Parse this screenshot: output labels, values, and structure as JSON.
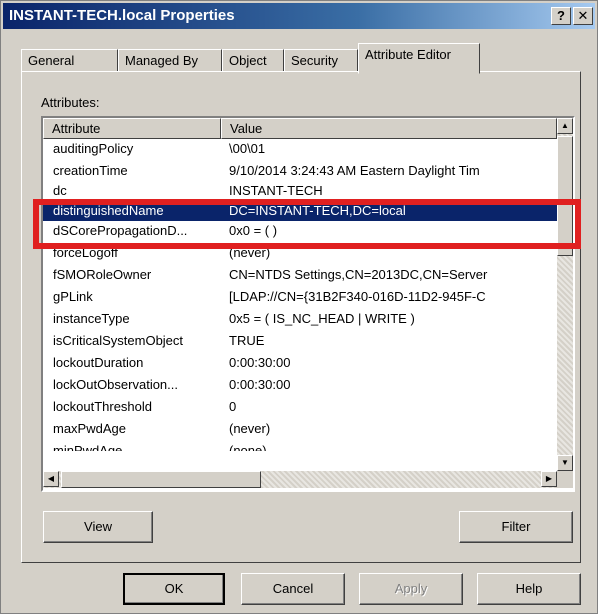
{
  "window": {
    "title": "INSTANT-TECH.local Properties",
    "help_label": "?",
    "close_label": "✕"
  },
  "tabs": [
    {
      "label": "General"
    },
    {
      "label": "Managed By"
    },
    {
      "label": "Object"
    },
    {
      "label": "Security"
    },
    {
      "label": "Attribute Editor",
      "active": true
    }
  ],
  "attributes": {
    "caption": "Attributes:",
    "header": {
      "attribute": "Attribute",
      "value": "Value"
    },
    "rows": [
      {
        "name": "auditingPolicy",
        "value": "\\00\\01"
      },
      {
        "name": "creationTime",
        "value": "9/10/2014 3:24:43 AM Eastern Daylight Tim"
      },
      {
        "name": "dc",
        "value": "INSTANT-TECH"
      },
      {
        "name": "distinguishedName",
        "value": "DC=INSTANT-TECH,DC=local",
        "selected": true
      },
      {
        "name": "dSCorePropagationD...",
        "value": "0x0 = ( )"
      },
      {
        "name": "forceLogoff",
        "value": "(never)"
      },
      {
        "name": "fSMORoleOwner",
        "value": "CN=NTDS Settings,CN=2013DC,CN=Server"
      },
      {
        "name": "gPLink",
        "value": "[LDAP://CN={31B2F340-016D-11D2-945F-C"
      },
      {
        "name": "instanceType",
        "value": "0x5 = ( IS_NC_HEAD | WRITE )"
      },
      {
        "name": "isCriticalSystemObject",
        "value": "TRUE"
      },
      {
        "name": "lockoutDuration",
        "value": "0:00:30:00"
      },
      {
        "name": "lockOutObservation...",
        "value": "0:00:30:00"
      },
      {
        "name": "lockoutThreshold",
        "value": "0"
      },
      {
        "name": "maxPwdAge",
        "value": "(never)"
      },
      {
        "name": "minPwdAge",
        "value": "(none)"
      }
    ]
  },
  "buttons": {
    "view": "View",
    "filter": "Filter",
    "ok": "OK",
    "cancel": "Cancel",
    "apply": "Apply",
    "help": "Help"
  },
  "colors": {
    "selection": "#0a246a",
    "highlight_box": "#e02020"
  }
}
